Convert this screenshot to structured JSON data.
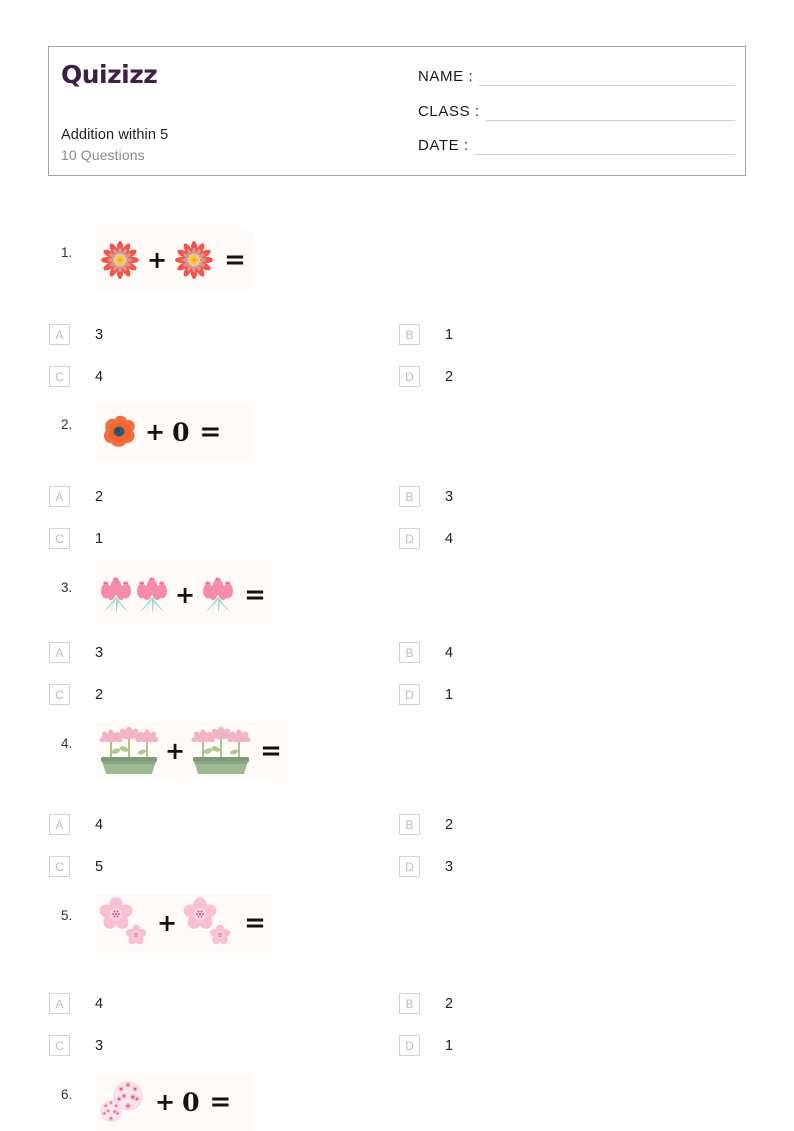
{
  "header": {
    "logo_text": "Quizizz",
    "logo_color": "#3d2046",
    "title": "Addition within 5",
    "subtitle": "10 Questions",
    "fields": [
      {
        "label": "NAME :",
        "value": ""
      },
      {
        "label": "CLASS :",
        "value": ""
      },
      {
        "label": "DATE  :",
        "value": ""
      }
    ]
  },
  "symbols": {
    "plus": "+",
    "equals": "=",
    "zero": "0"
  },
  "questions": [
    {
      "number": "1.",
      "left_count": 1,
      "right_count": 1,
      "right_is_zero": false,
      "flower": "red-daisy",
      "options": [
        {
          "letter": "A",
          "text": "3"
        },
        {
          "letter": "B",
          "text": "1"
        },
        {
          "letter": "C",
          "text": "4"
        },
        {
          "letter": "D",
          "text": "2"
        }
      ]
    },
    {
      "number": "2.",
      "left_count": 1,
      "right_count": 0,
      "right_is_zero": true,
      "flower": "orange-poppy",
      "options": [
        {
          "letter": "A",
          "text": "2"
        },
        {
          "letter": "B",
          "text": "3"
        },
        {
          "letter": "C",
          "text": "1"
        },
        {
          "letter": "D",
          "text": "4"
        }
      ]
    },
    {
      "number": "3.",
      "left_count": 2,
      "right_count": 1,
      "right_is_zero": false,
      "flower": "pink-tulip-bouquet",
      "options": [
        {
          "letter": "A",
          "text": "3"
        },
        {
          "letter": "B",
          "text": "4"
        },
        {
          "letter": "C",
          "text": "2"
        },
        {
          "letter": "D",
          "text": "1"
        }
      ]
    },
    {
      "number": "4.",
      "left_count": 1,
      "right_count": 1,
      "right_is_zero": false,
      "flower": "flower-planter",
      "options": [
        {
          "letter": "A",
          "text": "4"
        },
        {
          "letter": "B",
          "text": "2"
        },
        {
          "letter": "C",
          "text": "5"
        },
        {
          "letter": "D",
          "text": "3"
        }
      ]
    },
    {
      "number": "5.",
      "left_count": 1,
      "right_count": 1,
      "right_is_zero": false,
      "flower": "cherry-blossom-pair",
      "options": [
        {
          "letter": "A",
          "text": "4"
        },
        {
          "letter": "B",
          "text": "2"
        },
        {
          "letter": "C",
          "text": "3"
        },
        {
          "letter": "D",
          "text": "1"
        }
      ]
    },
    {
      "number": "6.",
      "left_count": 1,
      "right_count": 0,
      "right_is_zero": true,
      "flower": "blossom-cluster",
      "options": []
    }
  ],
  "colors": {
    "header_border": "#a3a3a3",
    "field_line": "#cfcfcf",
    "option_box_border": "#d2d2d2",
    "option_letter": "#bcbcbc",
    "equation_bg": "#fdfaf8",
    "text": "#232323",
    "muted_text": "#8a8a8a"
  }
}
